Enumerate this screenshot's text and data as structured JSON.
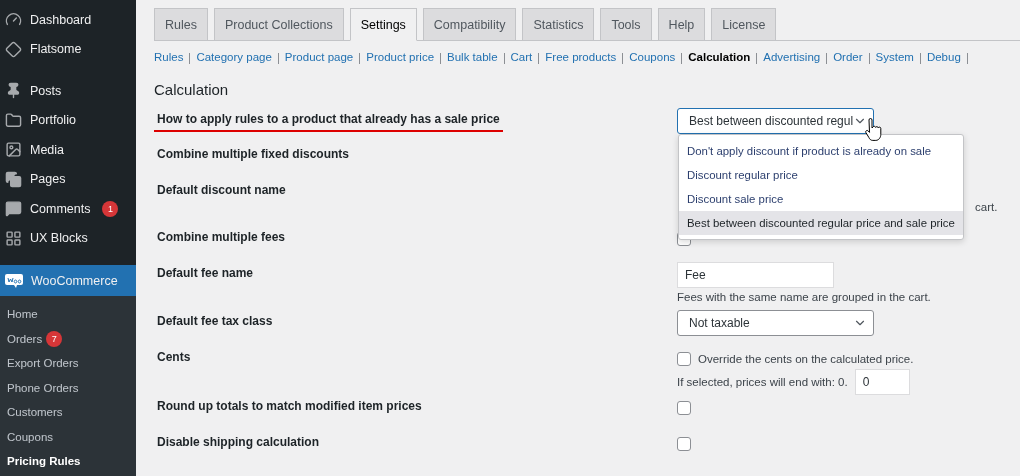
{
  "sidebar": {
    "items": [
      {
        "label": "Dashboard",
        "selected": false
      },
      {
        "label": "Flatsome",
        "selected": false
      },
      {
        "label": "Posts",
        "selected": false
      },
      {
        "label": "Portfolio",
        "selected": false
      },
      {
        "label": "Media",
        "selected": false
      },
      {
        "label": "Pages",
        "selected": false
      },
      {
        "label": "Comments",
        "selected": false,
        "badge": "1"
      },
      {
        "label": "UX Blocks",
        "selected": false
      },
      {
        "label": "WooCommerce",
        "selected": true
      }
    ],
    "submenu": [
      {
        "label": "Home",
        "selected": false
      },
      {
        "label": "Orders",
        "selected": false,
        "badge": "7"
      },
      {
        "label": "Export Orders",
        "selected": false
      },
      {
        "label": "Phone Orders",
        "selected": false
      },
      {
        "label": "Customers",
        "selected": false
      },
      {
        "label": "Coupons",
        "selected": false
      },
      {
        "label": "Pricing Rules",
        "selected": true
      }
    ]
  },
  "tabs": [
    {
      "label": "Rules",
      "selected": false
    },
    {
      "label": "Product Collections",
      "selected": false
    },
    {
      "label": "Settings",
      "selected": true
    },
    {
      "label": "Compatibility",
      "selected": false
    },
    {
      "label": "Statistics",
      "selected": false
    },
    {
      "label": "Tools",
      "selected": false
    },
    {
      "label": "Help",
      "selected": false
    },
    {
      "label": "License",
      "selected": false
    }
  ],
  "sublinks": [
    {
      "label": "Rules",
      "selected": false
    },
    {
      "label": "Category page",
      "selected": false
    },
    {
      "label": "Product page",
      "selected": false
    },
    {
      "label": "Product price",
      "selected": false
    },
    {
      "label": "Bulk table",
      "selected": false
    },
    {
      "label": "Cart",
      "selected": false
    },
    {
      "label": "Free products",
      "selected": false
    },
    {
      "label": "Coupons",
      "selected": false
    },
    {
      "label": "Calculation",
      "selected": true
    },
    {
      "label": "Advertising",
      "selected": false
    },
    {
      "label": "Order",
      "selected": false
    },
    {
      "label": "System",
      "selected": false
    },
    {
      "label": "Debug",
      "selected": false
    }
  ],
  "heading": "Calculation",
  "rows": [
    {
      "label": "How to apply rules to a product that already has a sale price",
      "highlighted": true,
      "kind": "select",
      "value": "Best between discounted regul",
      "expanded": true,
      "options": [
        {
          "label": "Don't apply discount if product is already on sale",
          "selected": false
        },
        {
          "label": "Discount regular price",
          "selected": false
        },
        {
          "label": "Discount sale price",
          "selected": false
        },
        {
          "label": "Best between discounted regular price and sale price",
          "selected": true
        }
      ]
    },
    {
      "label": "Combine multiple fixed discounts",
      "highlighted": false,
      "kind": "hidden"
    },
    {
      "label": "Default discount name",
      "highlighted": false,
      "kind": "covered-note",
      "note": "cart."
    },
    {
      "label": "Combine multiple fees",
      "highlighted": false,
      "kind": "checkbox",
      "checked": false
    },
    {
      "label": "Default fee name",
      "highlighted": false,
      "kind": "text",
      "value": "Fee",
      "note": "Fees with the same name are grouped in the cart."
    },
    {
      "label": "Default fee tax class",
      "highlighted": false,
      "kind": "select",
      "value": "Not taxable",
      "expanded": false
    },
    {
      "label": "Cents",
      "highlighted": false,
      "kind": "cents",
      "checked": false,
      "check_label": "Override the cents on the calculated price.",
      "note": "If selected, prices will end with: 0.",
      "value": "0"
    },
    {
      "label": "Round up totals to match modified item prices",
      "highlighted": false,
      "kind": "checkbox",
      "checked": false
    },
    {
      "label": "Disable shipping calculation",
      "highlighted": false,
      "kind": "checkbox",
      "checked": false
    }
  ]
}
